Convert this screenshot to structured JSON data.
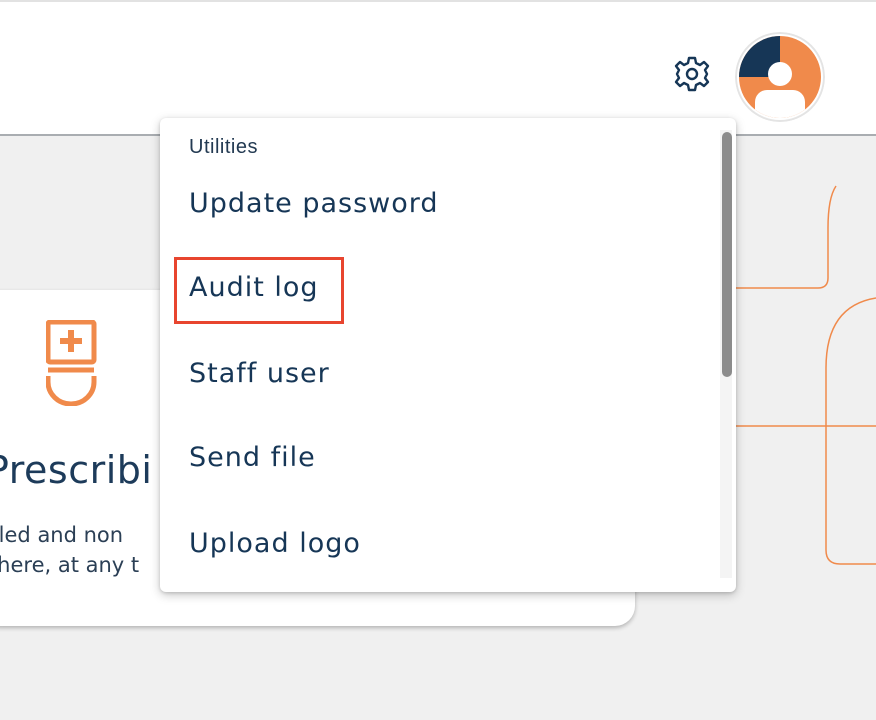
{
  "header": {
    "settings_icon": "gear-icon",
    "avatar_icon": "user-avatar-icon"
  },
  "card": {
    "icon": "prescription-icon",
    "title": "Prescribi",
    "description_lines": [
      "olled and non",
      "where, at any t"
    ]
  },
  "menu": {
    "section_label": "Utilities",
    "items": [
      {
        "label": "Update password"
      },
      {
        "label": "Audit log"
      },
      {
        "label": "Staff user"
      },
      {
        "label": "Send file"
      },
      {
        "label": "Upload logo"
      }
    ]
  },
  "colors": {
    "navy": "#163656",
    "orange": "#f08a4b",
    "highlight": "#e8452f"
  }
}
